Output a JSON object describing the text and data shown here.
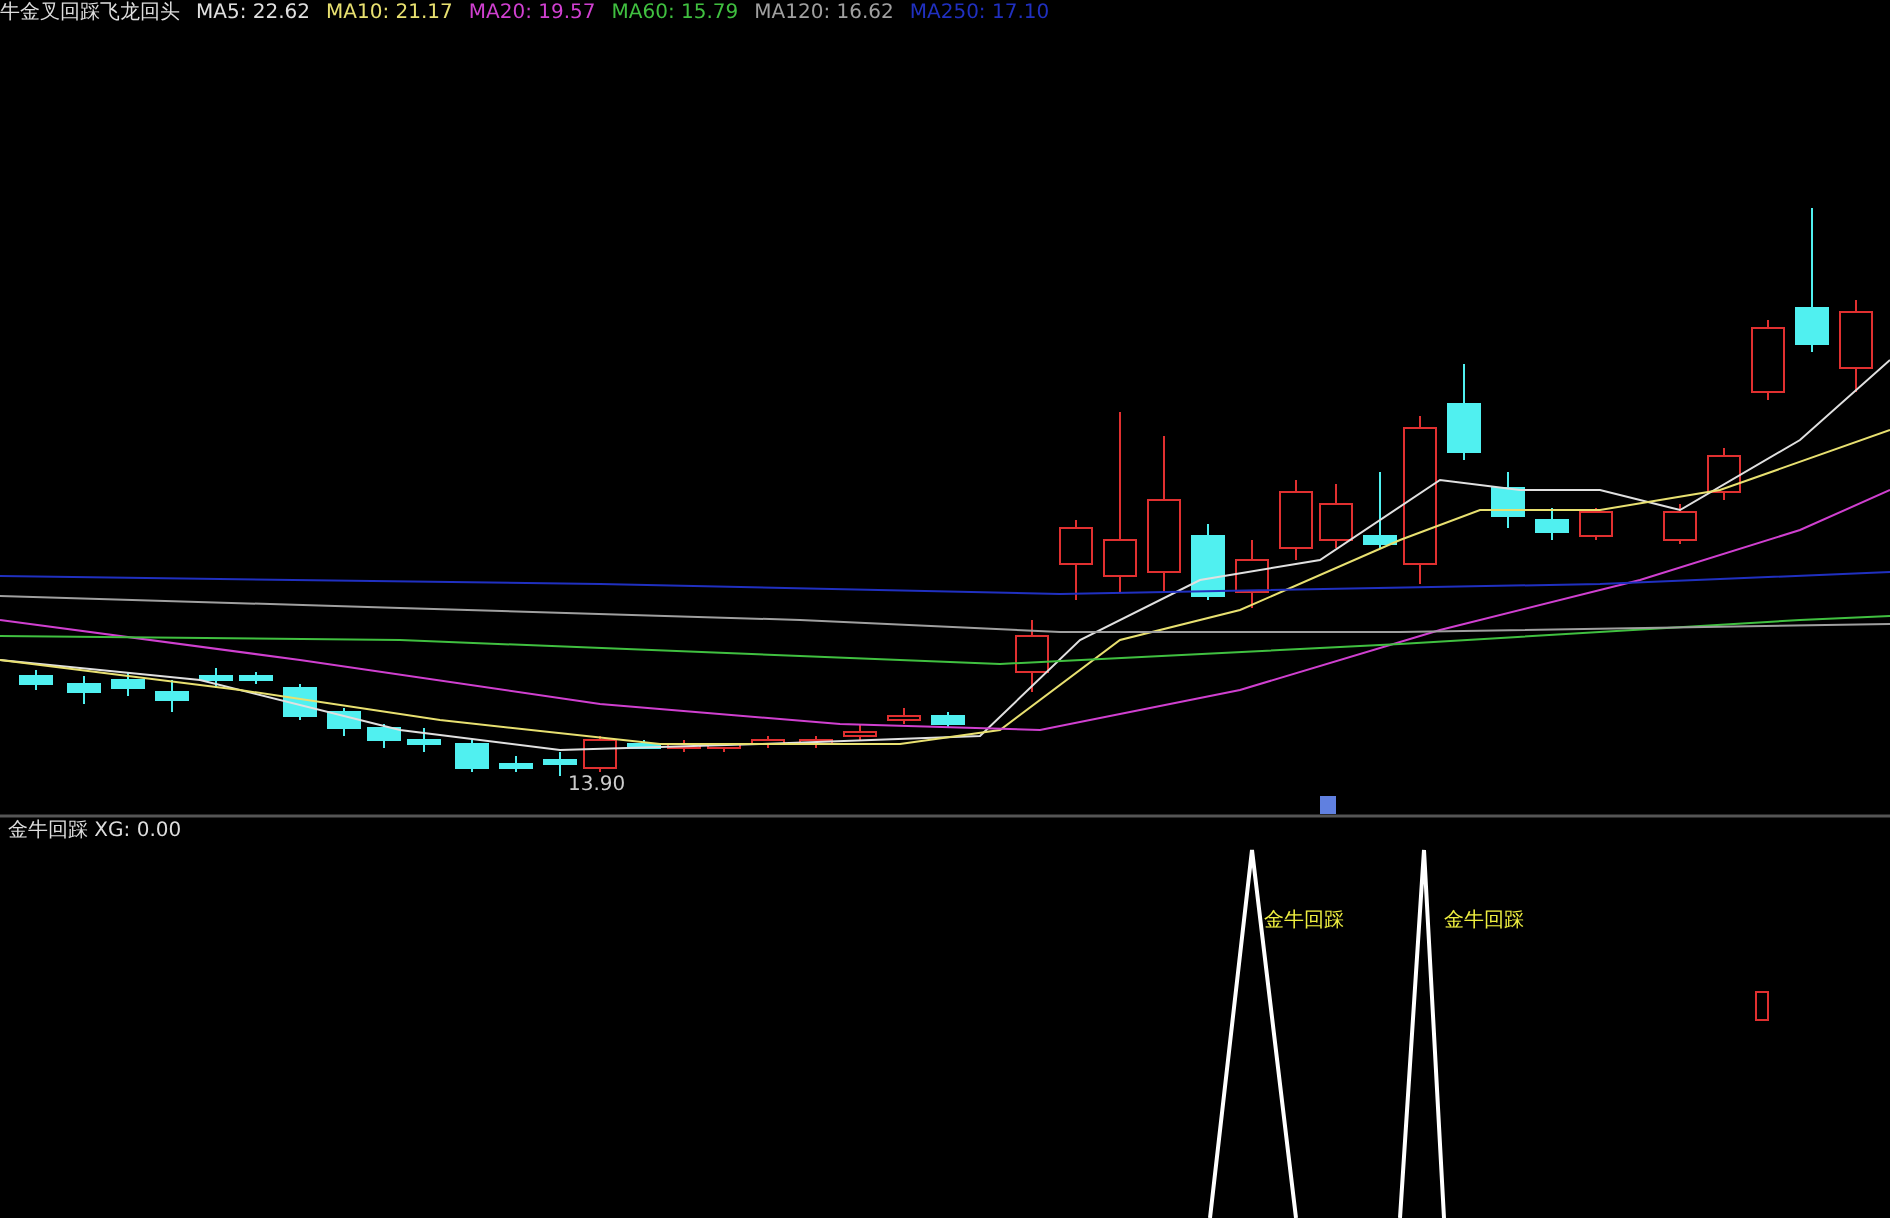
{
  "header": {
    "title": "牛金叉回踩飞龙回头",
    "legend": [
      {
        "text": "MA5: 22.62",
        "color": "#e0e0e0"
      },
      {
        "text": "MA10: 21.17",
        "color": "#e8e070"
      },
      {
        "text": "MA20: 19.57",
        "color": "#d040d0"
      },
      {
        "text": "MA60: 15.79",
        "color": "#40c040"
      },
      {
        "text": "MA120: 16.62",
        "color": "#a0a0a0"
      },
      {
        "text": "MA250: 17.10",
        "color": "#2030c0"
      }
    ]
  },
  "main_chart": {
    "low_label": "13.90"
  },
  "indicator": {
    "title": "金牛回踩 XG: 0.00",
    "signals": [
      {
        "text": "金牛回踩"
      },
      {
        "text": "金牛回踩"
      }
    ]
  }
}
